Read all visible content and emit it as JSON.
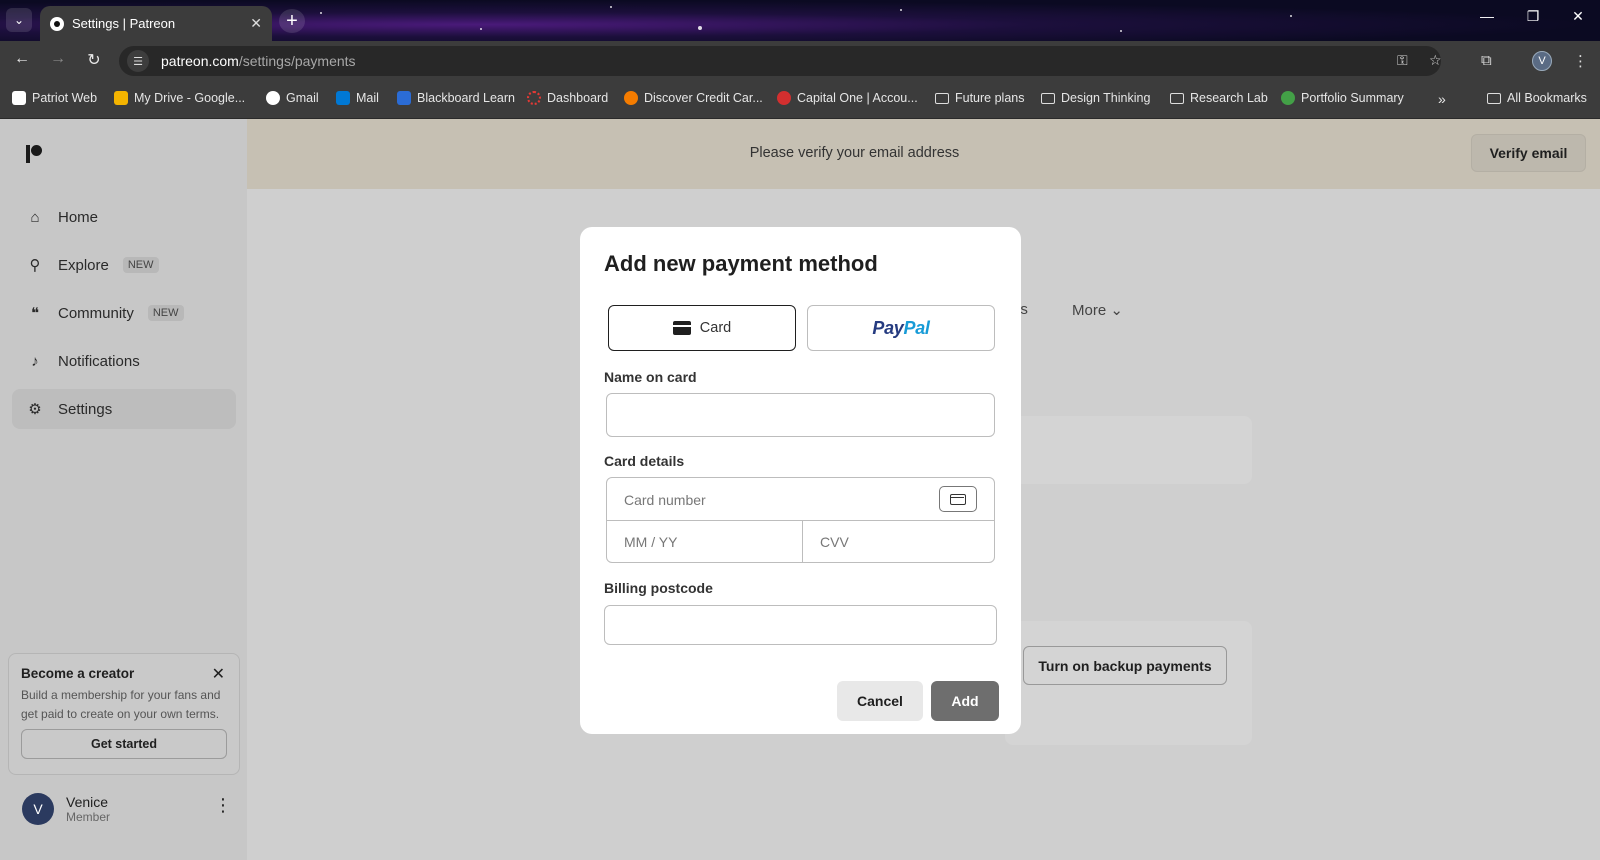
{
  "browser": {
    "tab_title": "Settings | Patreon",
    "url_host": "patreon.com",
    "url_path": "/settings/payments",
    "profile_initial": "V",
    "bookmarks": [
      {
        "label": "Patriot Web",
        "color": "#ffffff"
      },
      {
        "label": "My Drive - Google...",
        "color": "#f4b400"
      },
      {
        "label": "Gmail",
        "color": "#ea4335"
      },
      {
        "label": "Mail",
        "color": "#0078d4"
      },
      {
        "label": "Blackboard Learn",
        "color": "#2b6cd6"
      },
      {
        "label": "Dashboard",
        "color": "#e53935"
      },
      {
        "label": "Discover Credit Car...",
        "color": "#f57c00"
      },
      {
        "label": "Capital One | Accou...",
        "color": "#d32f2f"
      },
      {
        "label": "Future plans",
        "color": "folder"
      },
      {
        "label": "Design Thinking",
        "color": "folder"
      },
      {
        "label": "Research Lab",
        "color": "folder"
      },
      {
        "label": "Portfolio Summary",
        "color": "#43a047"
      }
    ],
    "all_bookmarks": "All Bookmarks"
  },
  "sidebar": {
    "items": [
      {
        "label": "Home",
        "icon": "home-icon",
        "glyph": "⌂"
      },
      {
        "label": "Explore",
        "icon": "search-icon",
        "glyph": "⚲",
        "badge": "NEW"
      },
      {
        "label": "Community",
        "icon": "chat-icon",
        "glyph": "💬",
        "badge": "NEW"
      },
      {
        "label": "Notifications",
        "icon": "bell-icon",
        "glyph": "🔔"
      },
      {
        "label": "Settings",
        "icon": "gear-icon",
        "glyph": "⚙"
      }
    ],
    "creator": {
      "title": "Become a creator",
      "description": "Build a membership for your fans and get paid to create on your own terms.",
      "button": "Get started"
    },
    "user": {
      "initial": "V",
      "name": "Venice",
      "role": "Member"
    }
  },
  "banner": {
    "text": "Please verify your email address",
    "button": "Verify email"
  },
  "background": {
    "tab_partial": "os",
    "more": "More",
    "backup_button": "Turn on backup payments"
  },
  "modal": {
    "title": "Add new payment method",
    "methods": {
      "card": "Card",
      "paypal_a": "Pay",
      "paypal_b": "Pal"
    },
    "name_label": "Name on card",
    "card_details_label": "Card details",
    "card_number_placeholder": "Card number",
    "expiry_placeholder": "MM / YY",
    "cvv_placeholder": "CVV",
    "postcode_label": "Billing postcode",
    "cancel": "Cancel",
    "add": "Add"
  }
}
